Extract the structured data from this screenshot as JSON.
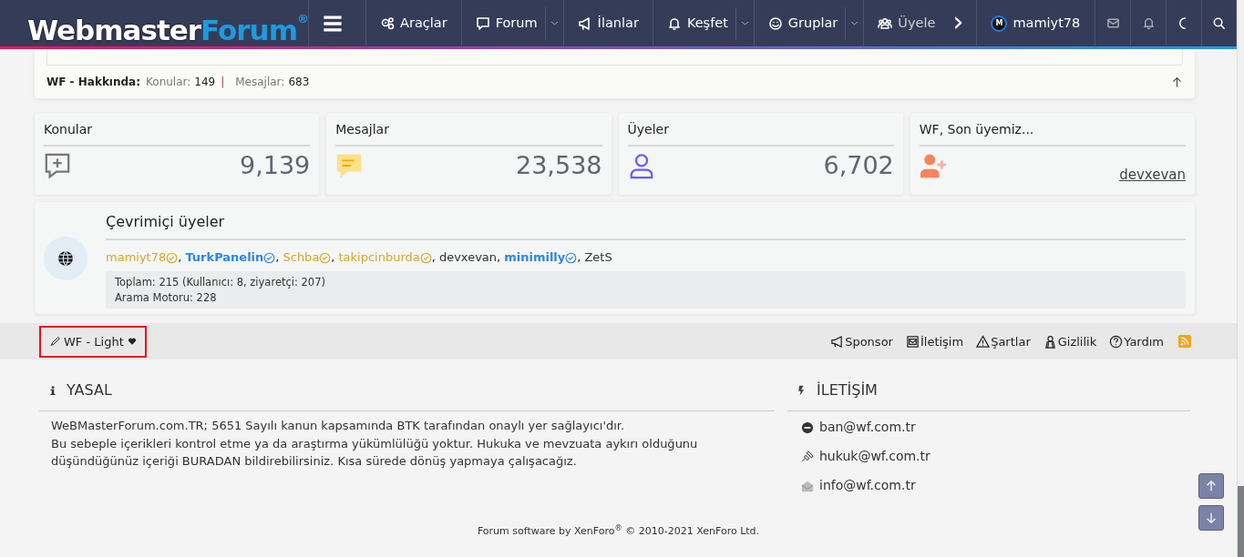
{
  "header": {
    "logo": {
      "part_1": "Webmaster",
      "part_2": "Forum",
      "mark": "®"
    },
    "nav": [
      {
        "kind": "menu"
      },
      {
        "kind": "link",
        "label": "Araçlar",
        "dropdown": false
      },
      {
        "kind": "link",
        "label": "Forum",
        "dropdown": true
      },
      {
        "kind": "link",
        "label": "İlanlar",
        "dropdown": false
      },
      {
        "kind": "link",
        "label": "Keşfet",
        "dropdown": true
      },
      {
        "kind": "link",
        "label": "Gruplar",
        "dropdown": true
      },
      {
        "kind": "link",
        "label": "Üyele",
        "dropdown": false,
        "faded": true
      },
      {
        "kind": "scroll",
        "label": "›"
      }
    ],
    "user": {
      "avatar_letter": "M",
      "name": "mamiyt78"
    }
  },
  "forum_info": {
    "title": "WF - Hakkında:",
    "stats": [
      {
        "label": "Konular:",
        "value": "149"
      },
      {
        "label": "Mesajlar:",
        "value": "683"
      }
    ],
    "separator": "|"
  },
  "stat_cards": [
    {
      "title": "Konular",
      "kind": "count",
      "value": "9,139"
    },
    {
      "title": "Mesajlar",
      "kind": "count",
      "value": "23,538"
    },
    {
      "title": "Üyeler",
      "kind": "count",
      "value": "6,702"
    },
    {
      "title": "WF, Son üyemiz...",
      "kind": "name",
      "value": "devxevan"
    }
  ],
  "online": {
    "title": "Çevrimiçi üyeler",
    "separator": ",",
    "members": [
      {
        "name": "mamiyt78",
        "color": "#d4a72c",
        "bold": false,
        "verified": true
      },
      {
        "name": "TurkPanelin",
        "color": "#2f86e0",
        "bold": true,
        "verified": true
      },
      {
        "name": "Schba",
        "color": "#d4a72c",
        "bold": false,
        "verified": true
      },
      {
        "name": "takipcinburda",
        "color": "#d4a72c",
        "bold": false,
        "verified": true
      },
      {
        "name": "devxevan",
        "color": "#333333",
        "bold": false,
        "verified": false
      },
      {
        "name": "minimilly",
        "color": "#2f86e0",
        "bold": true,
        "verified": true
      },
      {
        "name": "ZetS",
        "color": "#333333",
        "bold": false,
        "verified": false
      }
    ],
    "summary": [
      "Toplam: 215 (Kullanıcı: 8, ziyaretçi: 207)",
      "Arama Motoru: 228"
    ]
  },
  "footer_bar": {
    "style_chooser": {
      "label": "WF - Light",
      "outlined": true
    },
    "links": [
      {
        "label": "Sponsor"
      },
      {
        "label": "İletişim"
      },
      {
        "label": "Şartlar"
      },
      {
        "label": "Gizlilik"
      },
      {
        "label": "Yardım"
      }
    ]
  },
  "legal": {
    "title": "YASAL",
    "lines": [
      "WeBMasterForum.com.TR; 5651 Sayılı kanun kapsamında BTK tarafından onaylı yer sağlayıcı'dır.",
      "Bu sebeple içerikleri kontrol etme ya da araştırma yükümlülüğü yoktur. Hukuka ve mevzuata aykırı olduğunu düşündüğünüz içeriği BURADAN bildirebilirsiniz. Kısa sürede dönüş yapmaya çalışacağız."
    ]
  },
  "contact": {
    "title": "İLETİŞİM",
    "items": [
      {
        "label": "ban@wf.com.tr"
      },
      {
        "label": "hukuk@wf.com.tr"
      },
      {
        "label": "info@wf.com.tr"
      }
    ]
  },
  "copyright": "Forum software by XenForo$^{®}$ © 2010-2021 XenForo Ltd."
}
